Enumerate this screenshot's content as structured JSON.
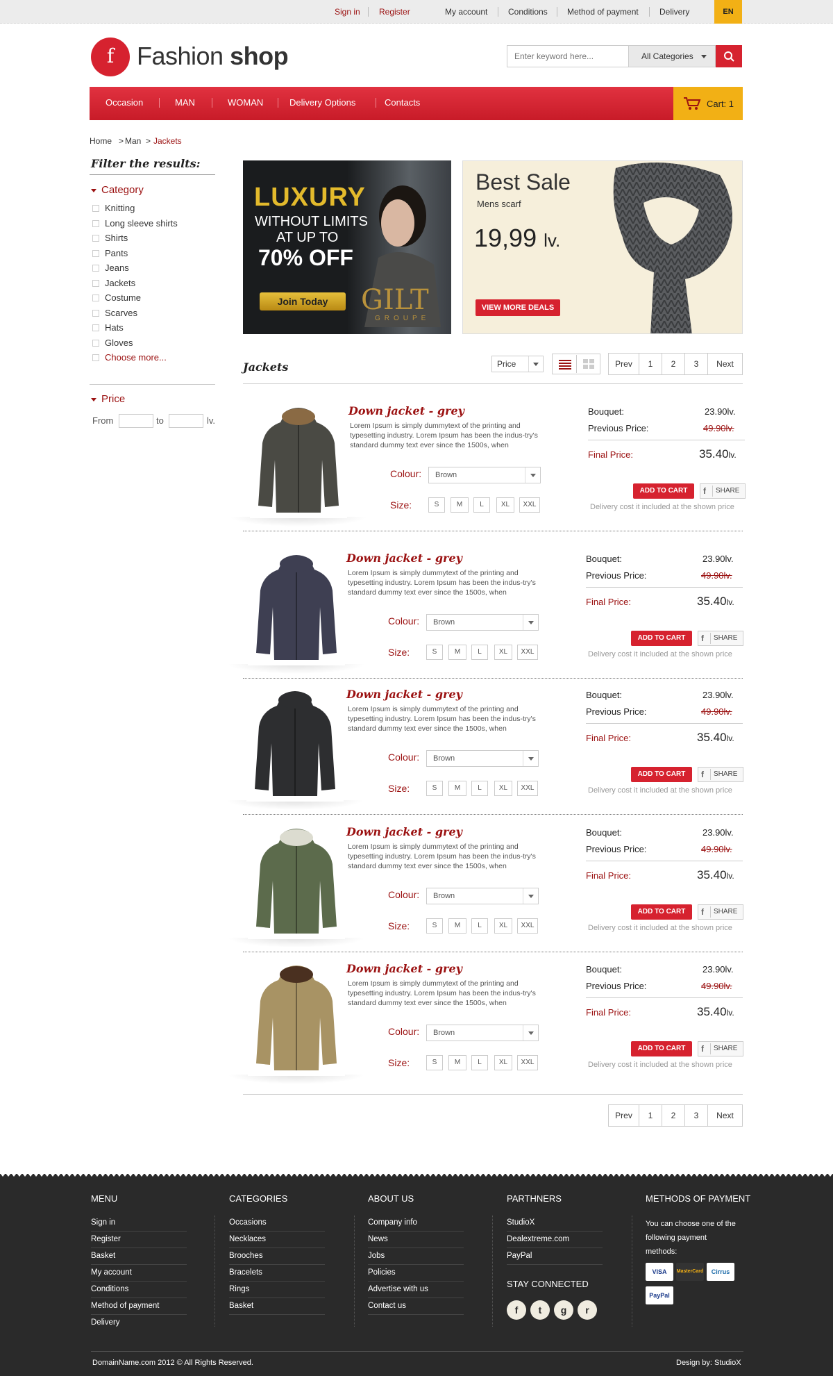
{
  "topbar": {
    "sign_in": "Sign in",
    "register": "Register",
    "my_account": "My account",
    "conditions": "Conditions",
    "method_of_payment": "Method of payment",
    "delivery": "Delivery",
    "lang": "EN"
  },
  "header": {
    "logo_letter": "f",
    "logo_light": "Fashion",
    "logo_bold": "shop",
    "search_placeholder": "Enter keyword here...",
    "category_select": "All Categories"
  },
  "nav": {
    "items": [
      "Occasion",
      "MAN",
      "WOMAN",
      "Delivery Options",
      "Contacts"
    ],
    "cart": "Cart: 1"
  },
  "breadcrumb": {
    "home": "Home",
    "man": "Man",
    "current": "Jackets",
    "sep": ">"
  },
  "sidebar": {
    "title": "Filter the results:",
    "category_heading": "Category",
    "categories": [
      "Knitting",
      "Long sleeve shirts",
      "Shirts",
      "Pants",
      "Jeans",
      "Jackets",
      "Costume",
      "Scarves",
      "Hats",
      "Gloves"
    ],
    "choose_more": "Choose more...",
    "price_heading": "Price",
    "from": "From",
    "to": "to",
    "currency": "lv."
  },
  "banners": {
    "luxury": {
      "line1": "LUXURY",
      "line2": "WITHOUT LIMITS",
      "line3": "AT UP TO",
      "line4": "70% OFF",
      "button": "Join Today",
      "brand": "GILT",
      "brand_sub": "GROUPE"
    },
    "sale": {
      "title": "Best Sale",
      "subtitle": "Mens scarf",
      "price": "19,99",
      "currency": "lv.",
      "button": "VIEW MORE DEALS"
    }
  },
  "listing": {
    "title": "Jackets",
    "sort": "Price",
    "pagination": [
      "Prev",
      "1",
      "2",
      "3",
      "Next"
    ]
  },
  "product": {
    "name": "Down jacket - grey",
    "description": "Lorem Ipsum is simply dummytext of the printing and typesetting industry. Lorem Ipsum has been the indus-try's standard dummy text ever since the 1500s, when",
    "colour_label": "Colour:",
    "colour_value": "Brown",
    "size_label": "Size:",
    "sizes": [
      "S",
      "M",
      "L",
      "XL",
      "XXL"
    ],
    "bouquet_label": "Bouquet:",
    "bouquet_value": "23.90lv.",
    "previous_label": "Previous Price:",
    "previous_value": "49.90lv.",
    "final_label": "Final Price:",
    "final_value": "35.40",
    "final_currency": "lv.",
    "add_to_cart": "ADD TO CART",
    "share": "SHARE",
    "delivery_note": "Delivery cost it included at the shown price"
  },
  "product_colors": [
    "#4a4a44",
    "#3e3f52",
    "#2d2e30",
    "#5c6b4c",
    "#a89364"
  ],
  "footer": {
    "menu": {
      "heading": "MENU",
      "links": [
        "Sign in",
        "Register",
        "Basket",
        "My account",
        "Conditions",
        "Method of payment",
        "Delivery"
      ]
    },
    "categories": {
      "heading": "CATEGORIES",
      "links": [
        "Occasions",
        "Necklaces",
        "Brooches",
        "Bracelets",
        "Rings",
        "Basket"
      ]
    },
    "about": {
      "heading": "ABOUT US",
      "links": [
        "Company info",
        "News",
        "Jobs",
        "Policies",
        "Advertise with us",
        "Contact us"
      ]
    },
    "partners": {
      "heading": "PARTHNERS",
      "links": [
        "StudioX",
        "Dealextreme.com",
        "PayPal"
      ]
    },
    "stay_connected": "STAY CONNECTED",
    "payment": {
      "heading": "METHODS OF PAYMENT",
      "text": "You can choose one of the following payment methods:",
      "cards": [
        "VISA",
        "MasterCard",
        "Cirrus",
        "PayPal"
      ]
    },
    "copyright": "DomainName.com 2012 © All Rights Reserved.",
    "design": "Design by: StudioX"
  },
  "colors": {
    "accent_red": "#d6222f",
    "dark_red": "#9b1111",
    "yellow": "#f2b015",
    "footer_bg": "#2a2a2a"
  }
}
